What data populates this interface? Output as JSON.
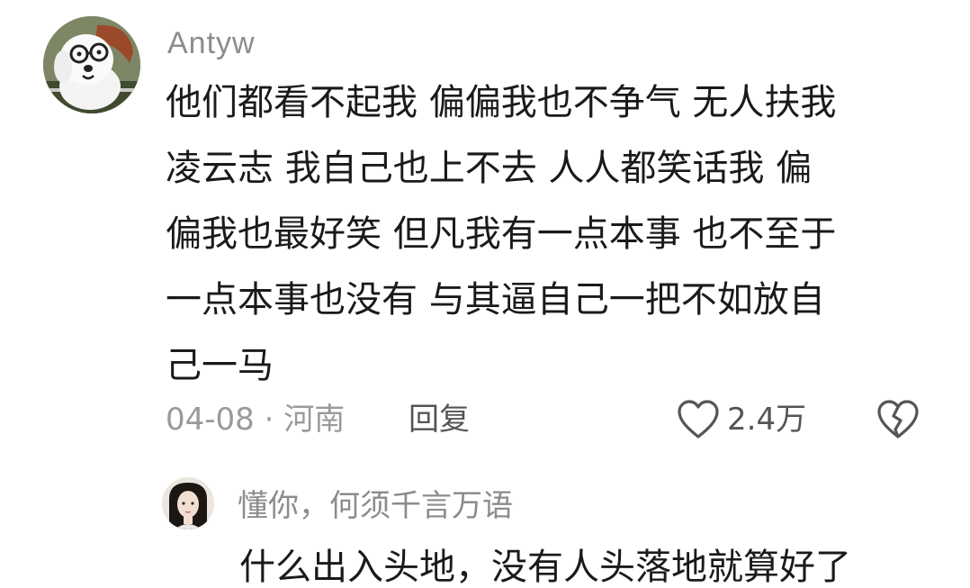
{
  "comment": {
    "username": "Antyw",
    "lines": [
      "他们都看不起我  偏偏我也不争气  无人扶我",
      "凌云志  我自己也上不去  人人都笑话我  偏",
      "偏我也最好笑  但凡我有一点本事  也不至于",
      "一点本事也没有  与其逼自己一把不如放自",
      "己一马"
    ],
    "meta": "04-08 · 河南",
    "reply_label": "回复",
    "like_count": "2.4万",
    "icons": [
      "heart-icon",
      "broken-heart-icon"
    ]
  },
  "reply": {
    "username": "懂你，何须千言万语",
    "text": "什么出入头地，没有人头落地就算好了"
  },
  "colors": {
    "username": "#8c8c8c",
    "text": "#1a1a1a",
    "meta": "#9a9a9a",
    "action": "#555555"
  }
}
